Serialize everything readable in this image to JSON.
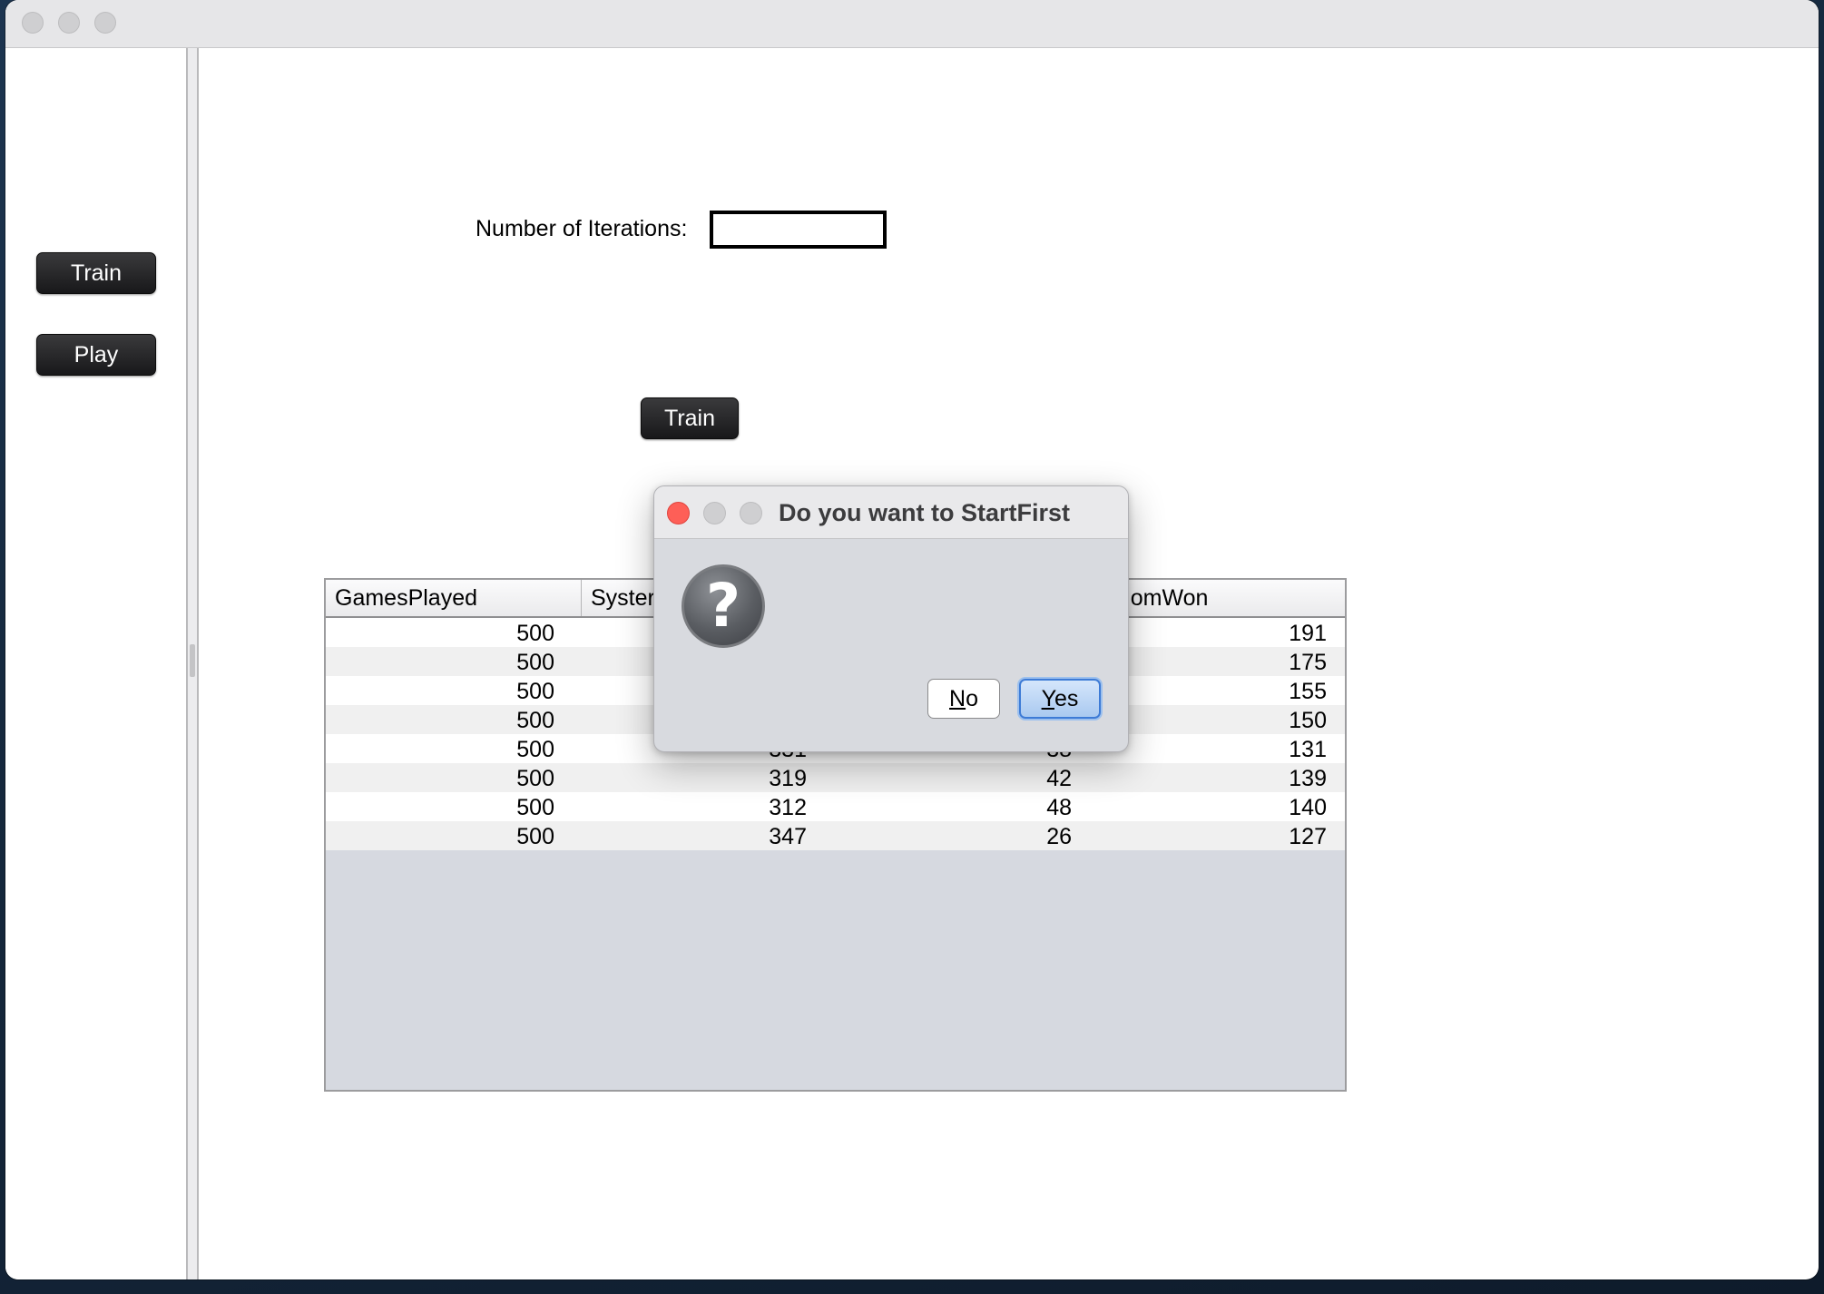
{
  "sidebar": {
    "train_label": "Train",
    "play_label": "Play"
  },
  "form": {
    "iterations_label": "Number of Iterations:",
    "iterations_value": "",
    "train_button": "Train"
  },
  "table": {
    "columns": [
      "GamesPlayed",
      "Syster",
      "andomWon"
    ],
    "rows": [
      [
        "500",
        "",
        "",
        "191"
      ],
      [
        "500",
        "",
        "",
        "175"
      ],
      [
        "500",
        "",
        "",
        "155"
      ],
      [
        "500",
        "",
        "",
        "150"
      ],
      [
        "500",
        "331",
        "38",
        "131"
      ],
      [
        "500",
        "319",
        "42",
        "139"
      ],
      [
        "500",
        "312",
        "48",
        "140"
      ],
      [
        "500",
        "347",
        "26",
        "127"
      ]
    ]
  },
  "dialog": {
    "title": "Do you want to StartFirst",
    "no_label": "No",
    "yes_label": "Yes",
    "no_mnemonic": "N",
    "no_rest": "o",
    "yes_mnemonic": "Y",
    "yes_rest": "es"
  },
  "colors": {
    "close_red": "#fe5f57",
    "accent_blue": "#3d7bd6"
  }
}
